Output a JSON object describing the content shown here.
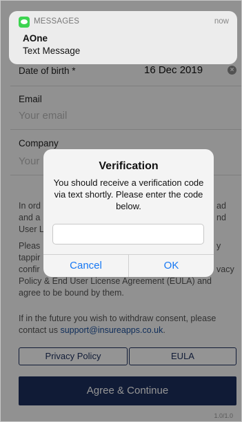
{
  "notification": {
    "app": "MESSAGES",
    "time": "now",
    "sender": "AOne",
    "body": "Text Message"
  },
  "form": {
    "dob_label": "Date of birth *",
    "dob_value": "16 Dec 2019",
    "email_label": "Email",
    "email_placeholder": "Your email",
    "company_label": "Company",
    "company_placeholder": "Your",
    "consent_left_1": "In ord",
    "consent_left_2": "and a",
    "consent_left_3": "User L",
    "consent_right_1": "ad",
    "consent_right_2": "nd",
    "please_left_1": "Pleas",
    "please_left_2": "tappir",
    "please_left_3": "confir",
    "please_right_1": "y",
    "please_right_2": "vacy",
    "please_line_4": "Policy & End User License Agreement (EULA) and",
    "please_line_5": "agree to be bound by them.",
    "future_line_1": "If in the future you wish to withdraw consent, please",
    "future_line_2_prefix": "contact us ",
    "support_email": "support@insureapps.co.uk",
    "future_line_2_suffix": ".",
    "privacy_button": "Privacy Policy",
    "eula_button": "EULA",
    "agree_button": "Agree & Continue",
    "version": "1.0/1.0"
  },
  "dialog": {
    "title": "Verification",
    "message": "You should receive a verification code via text shortly. Please enter the code below.",
    "cancel_label": "Cancel",
    "ok_label": "OK"
  }
}
